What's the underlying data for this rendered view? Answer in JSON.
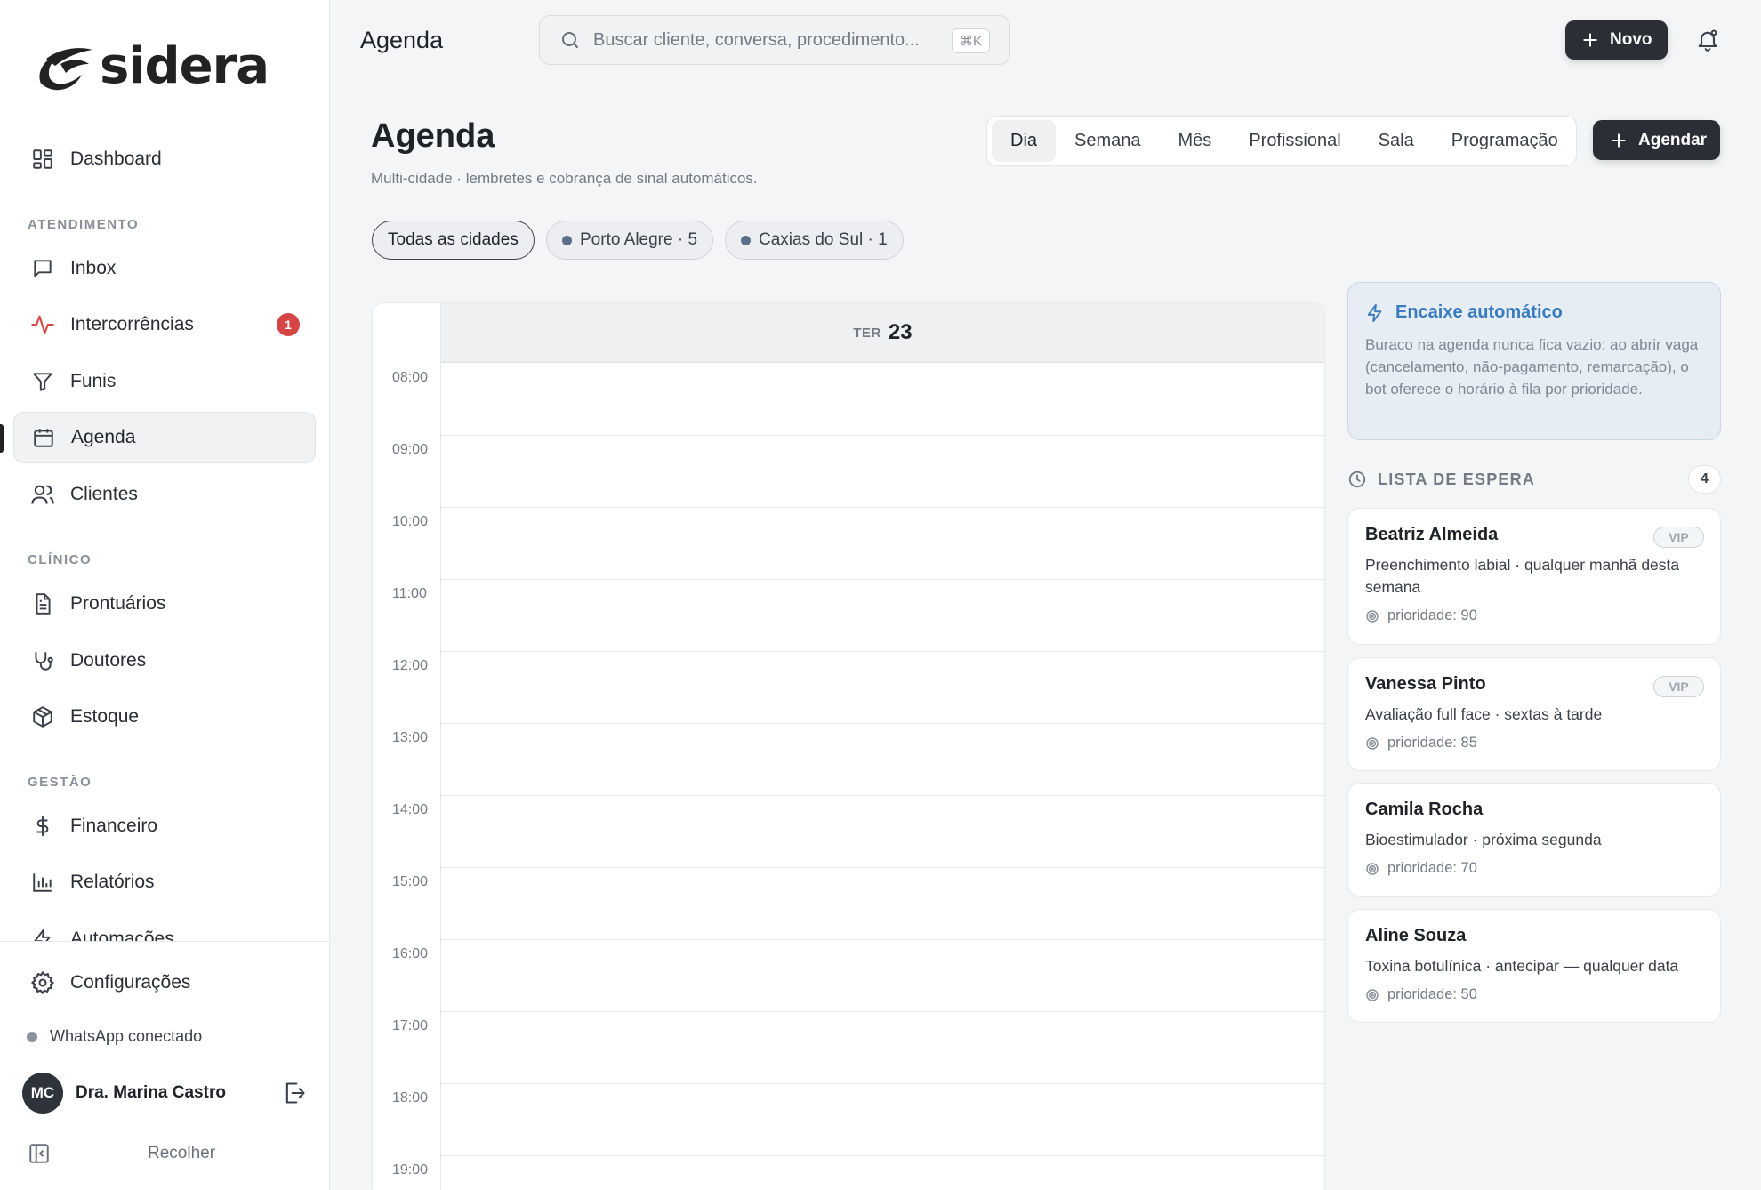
{
  "brand": {
    "name": "sidera"
  },
  "nav": {
    "dashboard": "Dashboard",
    "sections": {
      "atendimento": "ATENDIMENTO",
      "clinico": "CLÍNICO",
      "gestao": "GESTÃO"
    },
    "inbox": "Inbox",
    "intercorrencias": "Intercorrências",
    "intercorrencias_badge": "1",
    "funis": "Funis",
    "agenda": "Agenda",
    "clientes": "Clientes",
    "prontuarios": "Prontuários",
    "doutores": "Doutores",
    "estoque": "Estoque",
    "financeiro": "Financeiro",
    "relatorios": "Relatórios",
    "automacoes": "Automações",
    "configuracoes": "Configurações",
    "active": "agenda"
  },
  "status": {
    "whatsapp": "WhatsApp conectado"
  },
  "user": {
    "initials": "MC",
    "name": "Dra. Marina Castro"
  },
  "collapse_label": "Recolher",
  "topbar": {
    "title": "Agenda",
    "search_placeholder": "Buscar cliente, conversa, procedimento...",
    "shortcut": "⌘K",
    "new_label": "Novo"
  },
  "page": {
    "title": "Agenda",
    "subtitle": "Multi-cidade · lembretes e cobrança de sinal automáticos.",
    "views": [
      "Dia",
      "Semana",
      "Mês",
      "Profissional",
      "Sala",
      "Programação"
    ],
    "active_view": "Dia",
    "schedule_label": "Agendar"
  },
  "cities": [
    {
      "label": "Todas as cidades",
      "active": true
    },
    {
      "label": "Porto Alegre · 5",
      "active": false
    },
    {
      "label": "Caxias do Sul · 1",
      "active": false
    }
  ],
  "calendar": {
    "day_of_week": "TER",
    "day_number": "23",
    "hours": [
      "08:00",
      "09:00",
      "10:00",
      "11:00",
      "12:00",
      "13:00",
      "14:00",
      "15:00",
      "16:00",
      "17:00",
      "18:00",
      "19:00"
    ]
  },
  "auto_fill": {
    "title": "Encaixe automático",
    "body": "Buraco na agenda nunca fica vazio: ao abrir vaga (cancelamento, não-pagamento, remarcação), o bot oferece o horário à fila por prioridade."
  },
  "waitlist": {
    "title": "LISTA DE ESPERA",
    "count": "4",
    "items": [
      {
        "name": "Beatriz Almeida",
        "vip": "VIP",
        "desc": "Preenchimento labial · qualquer manhã desta semana",
        "priority": "prioridade: 90"
      },
      {
        "name": "Vanessa Pinto",
        "vip": "VIP",
        "desc": "Avaliação full face · sextas à tarde",
        "priority": "prioridade: 85"
      },
      {
        "name": "Camila Rocha",
        "vip": "",
        "desc": "Bioestimulador · próxima segunda",
        "priority": "prioridade: 70"
      },
      {
        "name": "Aline Souza",
        "vip": "",
        "desc": "Toxina botulínica · antecipar — qualquer data",
        "priority": "prioridade: 50"
      }
    ]
  },
  "colors": {
    "accent": "#2b2f35",
    "link_blue": "#3a7bbf",
    "badge_red": "#d64545"
  }
}
